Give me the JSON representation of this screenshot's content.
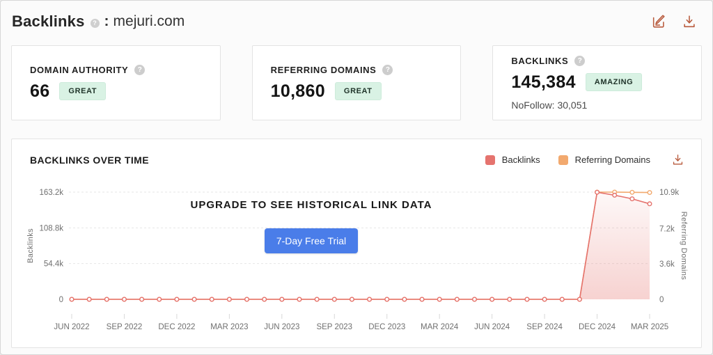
{
  "theme": {
    "accent": "#b85a3c",
    "badge_bg": "#d9f2e4",
    "badge_text": "#20342a",
    "badge_border": "#cdebdb",
    "button_blue": "#4a7de9"
  },
  "header": {
    "title": "Backlinks",
    "separator": ":",
    "domain": "mejuri.com"
  },
  "stats": [
    {
      "label": "DOMAIN AUTHORITY",
      "value": "66",
      "badge": "GREAT"
    },
    {
      "label": "REFERRING DOMAINS",
      "value": "10,860",
      "badge": "GREAT"
    },
    {
      "label": "BACKLINKS",
      "value": "145,384",
      "badge": "AMAZING",
      "sub": "NoFollow: 30,051"
    }
  ],
  "panel": {
    "title": "BACKLINKS OVER TIME",
    "legend": [
      {
        "label": "Backlinks",
        "color": "#e5736e"
      },
      {
        "label": "Referring Domains",
        "color": "#f2a96e"
      }
    ]
  },
  "overlay": {
    "message": "UPGRADE TO SEE HISTORICAL LINK DATA",
    "button": "7-Day Free Trial",
    "button_color": "#4a7de9"
  },
  "chart_data": {
    "type": "line",
    "title": "BACKLINKS OVER TIME",
    "x_tick_labels": [
      "JUN 2022",
      "SEP 2022",
      "DEC 2022",
      "MAR 2023",
      "JUN 2023",
      "SEP 2023",
      "DEC 2023",
      "MAR 2024",
      "JUN 2024",
      "SEP 2024",
      "DEC 2024",
      "MAR 2025"
    ],
    "x_resolution": "monthly points from JUN 2022 to MAR 2025",
    "grid": "horizontal-dashed",
    "legend_position": "top-right",
    "series": [
      {
        "name": "Backlinks",
        "axis": "left",
        "color": "#e5736e",
        "fill": true,
        "values": [
          0,
          0,
          0,
          0,
          0,
          0,
          0,
          0,
          0,
          0,
          0,
          0,
          0,
          0,
          0,
          0,
          0,
          0,
          0,
          0,
          0,
          0,
          0,
          0,
          0,
          0,
          0,
          0,
          0,
          0,
          163000,
          158500,
          153000,
          145384
        ]
      },
      {
        "name": "Referring Domains",
        "axis": "right",
        "color": "#f2a96e",
        "fill": false,
        "values": [
          0,
          0,
          0,
          0,
          0,
          0,
          0,
          0,
          0,
          0,
          0,
          0,
          0,
          0,
          0,
          0,
          0,
          0,
          0,
          0,
          0,
          0,
          0,
          0,
          0,
          0,
          0,
          0,
          0,
          0,
          10900,
          10900,
          10880,
          10860
        ]
      }
    ],
    "left_axis": {
      "label": "Backlinks",
      "max": 163200,
      "ticks": [
        {
          "label": "163.2k",
          "value": 163200
        },
        {
          "label": "108.8k",
          "value": 108800
        },
        {
          "label": "54.4k",
          "value": 54400
        },
        {
          "label": "0",
          "value": 0
        }
      ]
    },
    "right_axis": {
      "label": "Referring Domains",
      "max": 10900,
      "ticks": [
        {
          "label": "10.9k",
          "value": 10900
        },
        {
          "label": "7.2k",
          "value": 7200
        },
        {
          "label": "3.6k",
          "value": 3600
        },
        {
          "label": "0",
          "value": 0
        }
      ]
    }
  }
}
